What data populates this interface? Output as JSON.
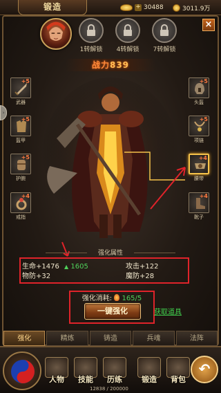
{
  "header": {
    "title": "锻造",
    "ingot_value": "30488",
    "gold_value": "3011.9万"
  },
  "unlock_slots": [
    {
      "label": "1转解锁"
    },
    {
      "label": "4转解锁"
    },
    {
      "label": "7转解锁"
    }
  ],
  "combat_power": {
    "label": "战力",
    "value": "839"
  },
  "equipment_left": [
    {
      "name": "武器",
      "level": "+5"
    },
    {
      "name": "盔甲",
      "level": "+5"
    },
    {
      "name": "护腕",
      "level": "+5"
    },
    {
      "name": "戒指",
      "level": "+4"
    }
  ],
  "equipment_right": [
    {
      "name": "头盔",
      "level": "+5"
    },
    {
      "name": "项链",
      "level": "+5"
    },
    {
      "name": "腰带",
      "level": "+4"
    },
    {
      "name": "靴子",
      "level": "+4"
    }
  ],
  "attributes": {
    "title": "强化属性",
    "hp": "生命+1476",
    "hp_gain": "1605",
    "attack": "攻击+122",
    "pdef": "物防+32",
    "mdef": "魔防+28"
  },
  "forge": {
    "cost_label": "强化消耗:",
    "cost_value": "165/5",
    "button_label": "一键强化",
    "get_items": "获取道具"
  },
  "sub_tabs": [
    "强化",
    "精炼",
    "铸造",
    "兵魂",
    "法阵"
  ],
  "bottom_nav": [
    "人物",
    "技能",
    "历练",
    "锻造",
    "背包"
  ],
  "exp_text": "12838 / 200000",
  "colors": {
    "accent": "#f5c24a",
    "annotation_red": "#e0232a",
    "gain_green": "#4fd15a"
  }
}
